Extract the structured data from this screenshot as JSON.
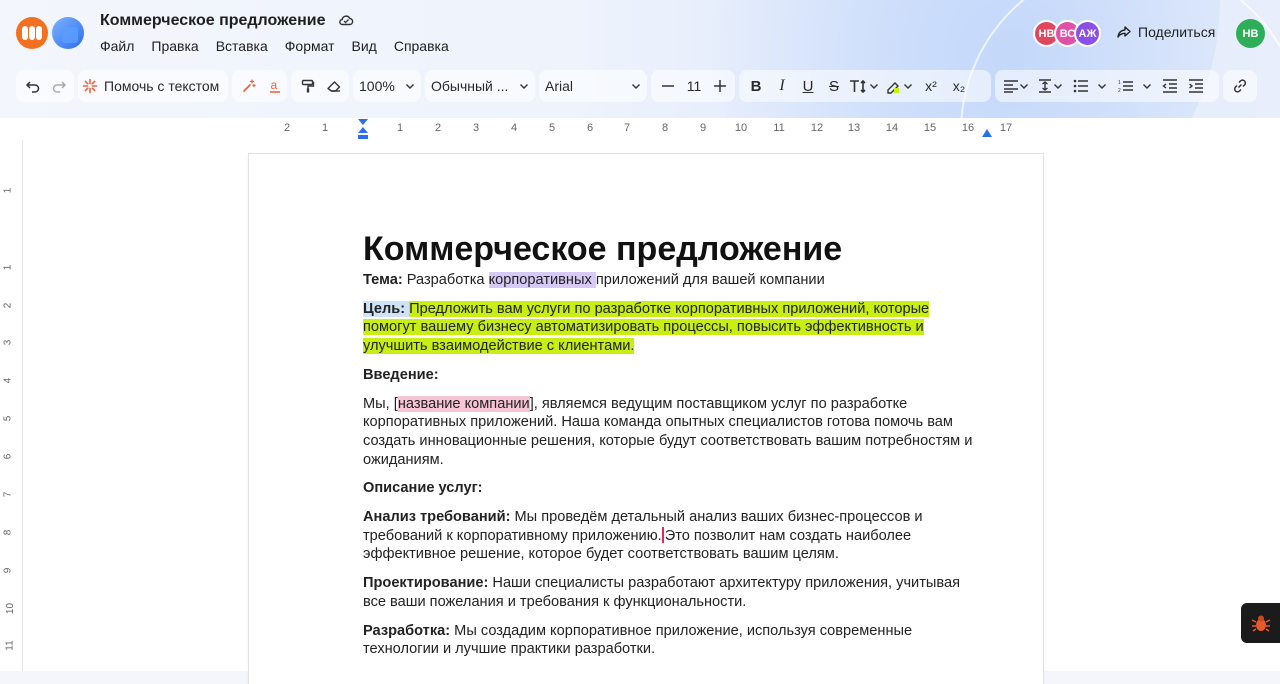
{
  "app": {
    "doc_title": "Коммерческое предложение",
    "menu": [
      "Файл",
      "Правка",
      "Вставка",
      "Формат",
      "Вид",
      "Справка"
    ],
    "avatars": [
      {
        "initials": "НВ",
        "color": "#e0475e"
      },
      {
        "initials": "ВС",
        "color": "#e04fa8"
      },
      {
        "initials": "АЖ",
        "color": "#8a4fe8"
      }
    ],
    "share_label": "Поделиться",
    "user_avatar": {
      "initials": "НВ",
      "color": "#2fae5a"
    }
  },
  "toolbar": {
    "assist_label": "Помочь с текстом",
    "zoom": "100%",
    "style": "Обычный ...",
    "font": "Arial",
    "font_size": "11",
    "superscript": "x²",
    "subscript": "x₂"
  },
  "ruler": {
    "ticks": [
      "2",
      "1",
      "1",
      "2",
      "3",
      "4",
      "5",
      "6",
      "7",
      "8",
      "9",
      "10",
      "11",
      "12",
      "13",
      "14",
      "15",
      "16",
      "17"
    ],
    "vticks": [
      "1",
      "1",
      "2",
      "3",
      "4",
      "5",
      "6",
      "7",
      "8",
      "9",
      "10",
      "11"
    ]
  },
  "document": {
    "title": "Коммерческое предложение",
    "topic_label": "Тема:",
    "topic_pre": " Разработка ",
    "topic_hl": "корпоративных ",
    "topic_post": "приложений для вашей компании",
    "goal_label": "Цель:",
    "goal_text": "Предложить вам услуги по разработке корпоративных приложений, которые помогут вашему бизнесу автоматизировать процессы, повысить эффективность и улучшить взаимодействие с клиентами.",
    "intro_heading": "Введение:",
    "intro_pre": "Мы, [",
    "intro_hl": "название компании",
    "intro_post": "], являемся ведущим поставщиком услуг по разработке корпоративных приложений. Наша команда опытных специалистов готова помочь вам создать инновационные решения, которые будут соответствовать вашим потребностям и ожиданиям.",
    "services_heading": "Описание услуг:",
    "analysis_label": "Анализ требований:",
    "analysis_pre": " Мы проведём детальный анализ ваших бизнес-процессов и требований к корпоративному приложению.",
    "analysis_post": "Это позволит нам создать наиболее эффективное решение, которое будет соответствовать вашим целям.",
    "design_label": "Проектирование:",
    "design_text": " Наши специалисты разработают архитектуру приложения, учитывая все ваши пожелания и требования к функциональности.",
    "dev_label": "Разработка:",
    "dev_text": " Мы создадим корпоративное приложение, используя современные технологии и лучшие практики разработки."
  }
}
